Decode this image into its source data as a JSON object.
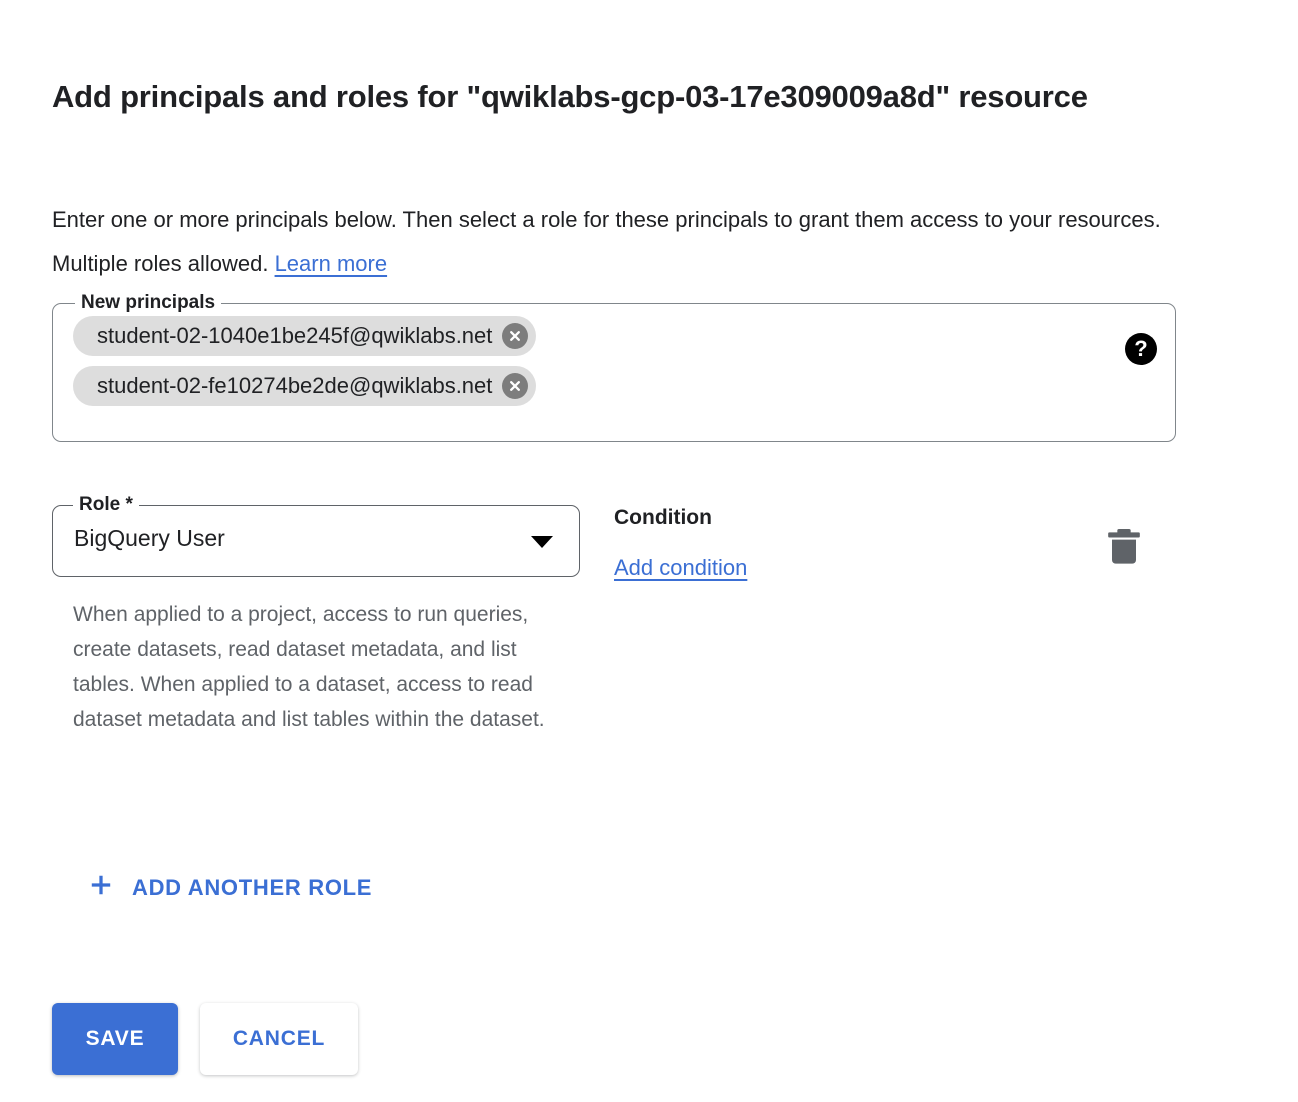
{
  "dialog": {
    "title": "Add principals and roles for \"qwiklabs-gcp-03-17e309009a8d\" resource",
    "description_part1": "Enter one or more principals below. Then select a role for these principals to grant them access to your resources. Multiple roles allowed.",
    "learn_more_label": "Learn more"
  },
  "principals": {
    "legend": "New principals",
    "help_icon": "help-icon",
    "help_glyph": "?",
    "chips": [
      {
        "label": "student-02-1040e1be245f@qwiklabs.net",
        "remove_icon": "close-icon"
      },
      {
        "label": "student-02-fe10274be2de@qwiklabs.net",
        "remove_icon": "close-icon"
      }
    ]
  },
  "role_row": {
    "role_legend": "Role *",
    "role_value": "BigQuery User",
    "dropdown_icon": "chevron-down-icon",
    "role_description": "When applied to a project, access to run queries, create datasets, read dataset metadata, and list tables. When applied to a dataset, access to read dataset metadata and list tables within the dataset.",
    "condition_title": "Condition",
    "add_condition_label": "Add condition",
    "delete_icon": "trash-icon"
  },
  "actions": {
    "add_another_role_label": "ADD ANOTHER ROLE",
    "add_icon": "plus-icon",
    "save_label": "SAVE",
    "cancel_label": "CANCEL"
  },
  "colors": {
    "accent_blue": "#3b6fd4",
    "link_blue": "#3b6fd4",
    "chip_background": "#dddddd",
    "muted_text": "#5f6368",
    "primary_text": "#202124",
    "border": "#80868b"
  }
}
